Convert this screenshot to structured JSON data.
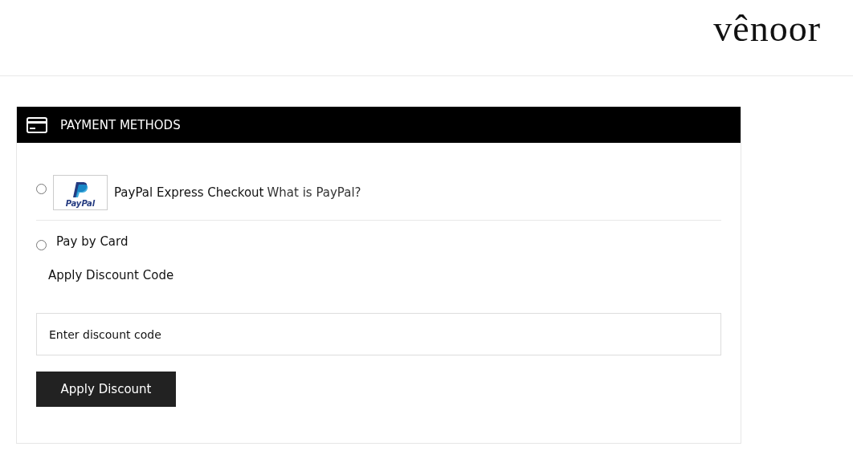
{
  "logo": "vênoor",
  "panel": {
    "title": "PAYMENT METHODS"
  },
  "methods": [
    {
      "kind": "paypal",
      "badge": "PayPal",
      "label": "PayPal Express Checkout",
      "link": "What is PayPal?",
      "selected": false
    },
    {
      "kind": "plain",
      "label": "Pay by Card",
      "selected": false
    }
  ],
  "discount": {
    "heading": "Apply Discount Code",
    "placeholder": "Enter discount code",
    "button": "Apply Discount"
  }
}
